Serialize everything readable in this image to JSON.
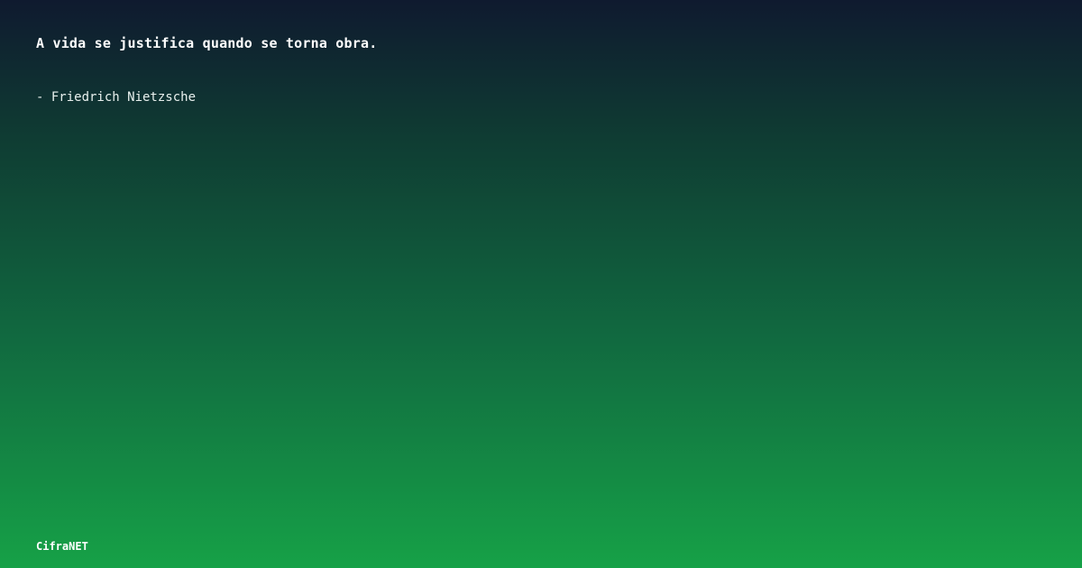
{
  "quote": {
    "text": "A vida se justifica quando se torna obra.",
    "author": "- Friedrich Nietzsche"
  },
  "brand": {
    "name": "CifraNET"
  },
  "colors": {
    "gradient_top": "#0f1a2f",
    "gradient_bottom": "#16a147",
    "text": "#ffffff"
  }
}
